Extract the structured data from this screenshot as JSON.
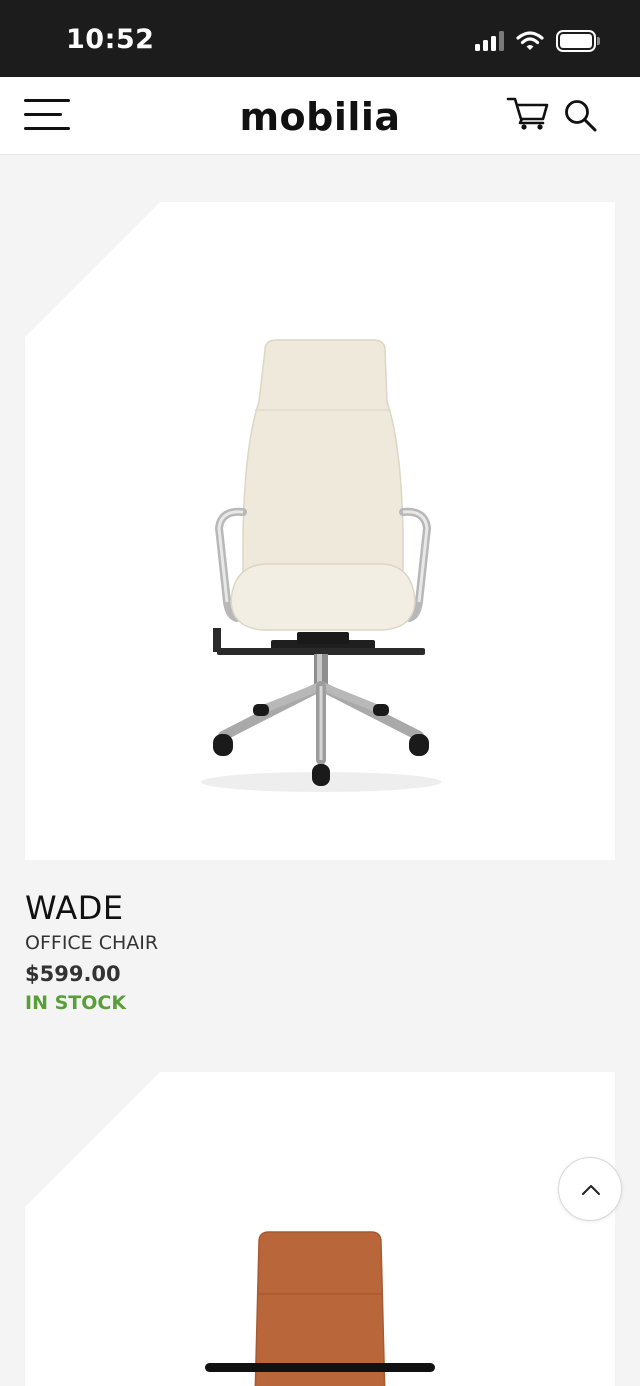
{
  "status_bar": {
    "time": "10:52",
    "icons": [
      "signal-icon",
      "wifi-icon",
      "battery-icon"
    ]
  },
  "header": {
    "logo": "mobilia",
    "icons": [
      "menu-icon",
      "cart-icon",
      "search-icon"
    ]
  },
  "products": [
    {
      "name": "WADE",
      "category": "OFFICE CHAIR",
      "price": "$599.00",
      "stock": "IN STOCK",
      "image": "white-office-chair"
    },
    {
      "image": "tan-office-chair"
    }
  ],
  "colors": {
    "status_bar_bg": "#1c1c1c",
    "page_bg": "#f4f4f4",
    "stock_green": "#5a9e3a",
    "chair_white": "#efe9dc",
    "chair_tan": "#b9673a"
  },
  "floating": {
    "scroll_top_icon": "chevron-up-icon"
  }
}
